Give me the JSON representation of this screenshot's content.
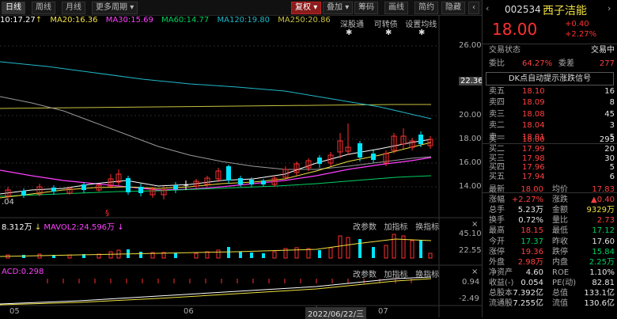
{
  "toolbar": {
    "left_tabs": [
      "日线",
      "周线",
      "月线",
      "更多周期"
    ],
    "right_tabs": [
      "复权",
      "叠加",
      "画线",
      "简",
      "筹码",
      "画线",
      "简约",
      "隐藏"
    ],
    "fuquan": "复权",
    "overlay": "叠加",
    "chip": "筹码",
    "draw": "画线",
    "simple": "简约",
    "hide": "隐藏"
  },
  "ma": {
    "ma10": "10:17.27",
    "ma20": "MA20:16.36",
    "ma30": "MA30:15.69",
    "ma60": "MA60:14.77",
    "ma120": "MA120:19.80",
    "ma250": "MA250:20.86",
    "arrows": [
      "↑",
      "↑",
      "↑",
      "↑",
      "↓",
      "↑"
    ]
  },
  "sub_tabs": [
    "深股通",
    "可转债",
    "设置均线"
  ],
  "price_axis": {
    "labels": [
      "26.00",
      "22.36",
      "20.00",
      "18.00",
      "16.00",
      "14.00"
    ],
    "current": "22.36"
  },
  "chart_labels": {
    "low_label": ".04",
    "mavol": "8.312万",
    "mavol2": "MAVOL2:24.596万",
    "vol_axis": [
      "45.10",
      "22.55"
    ],
    "macd_label": "ACD:0.298",
    "macd_axis": [
      "0.94",
      "-2.49"
    ],
    "dates": [
      "05",
      "06",
      "2022/06/22/三",
      "07"
    ],
    "vol_tabs": [
      "改参数",
      "加指标",
      "换指标"
    ],
    "macd_tabs": [
      "改参数",
      "加指标",
      "换指标"
    ]
  },
  "colors": {
    "up": "#ff3030",
    "down": "#00e5ff",
    "ma10": "#ffffff",
    "ma20": "#f0e040",
    "ma30": "#ff40ff",
    "ma60": "#00d060",
    "ma120": "#20b8c8",
    "ma250": "#c8c040"
  },
  "right_panel": {
    "code": "002534",
    "name": "西子洁能",
    "price": "18.00",
    "change": "+0.40",
    "pct": "+2.27%",
    "status_label": "交易状态",
    "status_value": "交易中",
    "ratio_label": "委比",
    "ratio_value": "64.27%",
    "diff_label": "委差",
    "diff_value": "277",
    "signal": "DK点自动提示涨跌信号",
    "asks": [
      {
        "label": "卖五",
        "price": "18.10",
        "vol": "16"
      },
      {
        "label": "卖四",
        "price": "18.09",
        "vol": "8"
      },
      {
        "label": "卖三",
        "price": "18.08",
        "vol": "45"
      },
      {
        "label": "卖二",
        "price": "18.04",
        "vol": "3"
      },
      {
        "label": "卖一",
        "price": "18.01",
        "vol": "5"
      }
    ],
    "bids": [
      {
        "label": "买一",
        "price": "18.00",
        "vol": "293"
      },
      {
        "label": "买二",
        "price": "17.99",
        "vol": "20"
      },
      {
        "label": "买三",
        "price": "17.98",
        "vol": "30"
      },
      {
        "label": "买四",
        "price": "17.96",
        "vol": "5"
      },
      {
        "label": "买五",
        "price": "17.94",
        "vol": "6"
      }
    ],
    "stats": [
      {
        "l1": "最新",
        "v1": "18.00",
        "c1": "red",
        "l2": "均价",
        "v2": "17.83",
        "c2": "red"
      },
      {
        "l1": "涨幅",
        "v1": "+2.27%",
        "c1": "red",
        "l2": "涨跌",
        "v2": "▲0.40",
        "c2": "red"
      },
      {
        "l1": "总手",
        "v1": "5.23万",
        "c1": "white",
        "l2": "金额",
        "v2": "9329万",
        "c2": "yellow"
      },
      {
        "l1": "换手",
        "v1": "0.72%",
        "c1": "white",
        "l2": "量比",
        "v2": "2.73",
        "c2": "red"
      },
      {
        "l1": "最高",
        "v1": "18.15",
        "c1": "red",
        "l2": "最低",
        "v2": "17.12",
        "c2": "green"
      },
      {
        "l1": "今开",
        "v1": "17.37",
        "c1": "green",
        "l2": "昨收",
        "v2": "17.60",
        "c2": "white"
      },
      {
        "l1": "涨停",
        "v1": "19.36",
        "c1": "red",
        "l2": "跌停",
        "v2": "15.84",
        "c2": "green"
      },
      {
        "l1": "外盘",
        "v1": "2.98万",
        "c1": "red",
        "l2": "内盘",
        "v2": "2.25万",
        "c2": "green"
      },
      {
        "l1": "净资产",
        "v1": "4.60",
        "c1": "white",
        "l2": "ROE",
        "v2": "1.10%",
        "c2": "white"
      },
      {
        "l1": "收益(-)",
        "v1": "0.054",
        "c1": "white",
        "l2": "PE(动)",
        "v2": "82.81",
        "c2": "white"
      },
      {
        "l1": "总股本",
        "v1": "7.392亿",
        "c1": "white",
        "l2": "总值",
        "v2": "133.1亿",
        "c2": "white"
      },
      {
        "l1": "流通股",
        "v1": "7.255亿",
        "c1": "white",
        "l2": "流值",
        "v2": "130.6亿",
        "c2": "white"
      }
    ]
  }
}
